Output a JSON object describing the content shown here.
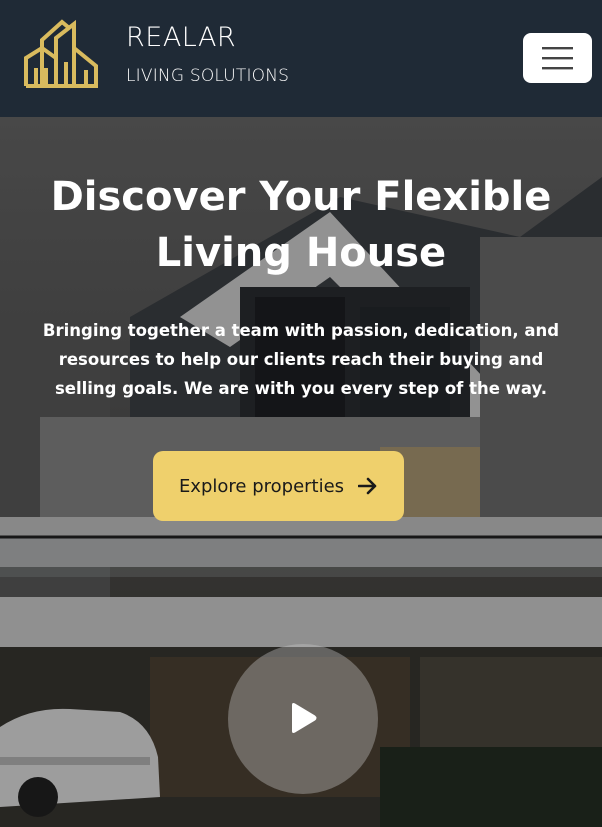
{
  "header": {
    "brand_name": "REALAR",
    "brand_tagline": "LIVING SOLUTIONS",
    "logo_icon": "building-outline-icon",
    "menu_icon": "hamburger-menu-icon"
  },
  "hero": {
    "title_line1": "Discover Your Flexible",
    "title_line2": "Living House",
    "description": "Bringing together a team with passion, dedication, and resources to help our clients reach their buying and selling goals. We are with you every step of the way.",
    "cta_label": "Explore properties",
    "cta_icon": "arrow-right-icon",
    "play_icon": "play-icon"
  },
  "colors": {
    "navbar_bg": "#1f2a36",
    "accent": "#efd06c",
    "logo_gold": "#d9bb5e"
  }
}
